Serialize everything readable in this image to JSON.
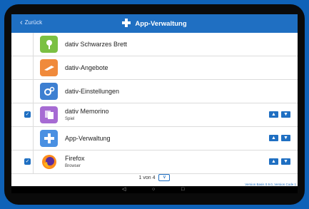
{
  "header": {
    "back_label": "Zurück",
    "title": "App-Verwaltung"
  },
  "rows": [
    {
      "name": "dativ Schwarzes Brett",
      "sub": "",
      "checked": false,
      "icon": "pin-icon",
      "color": "#7bc043"
    },
    {
      "name": "dativ-Angebote",
      "sub": "",
      "checked": false,
      "icon": "tag-icon",
      "color": "#f08a3b"
    },
    {
      "name": "dativ-Einstellungen",
      "sub": "",
      "checked": false,
      "icon": "gears-icon",
      "color": "#3d7fd1"
    },
    {
      "name": "dativ Memorino",
      "sub": "Spiel",
      "checked": true,
      "icon": "cards-icon",
      "color": "#a66bd3"
    },
    {
      "name": "App-Verwaltung",
      "sub": "",
      "checked": false,
      "icon": "plus-icon",
      "color": "#4a90e2"
    },
    {
      "name": "Firefox",
      "sub": "Browser",
      "checked": true,
      "icon": "firefox-icon",
      "color": "#ff8c1a"
    }
  ],
  "pager": {
    "label": "1 von 4"
  },
  "version": "Version Basis 0.9.0, Version Code 1"
}
